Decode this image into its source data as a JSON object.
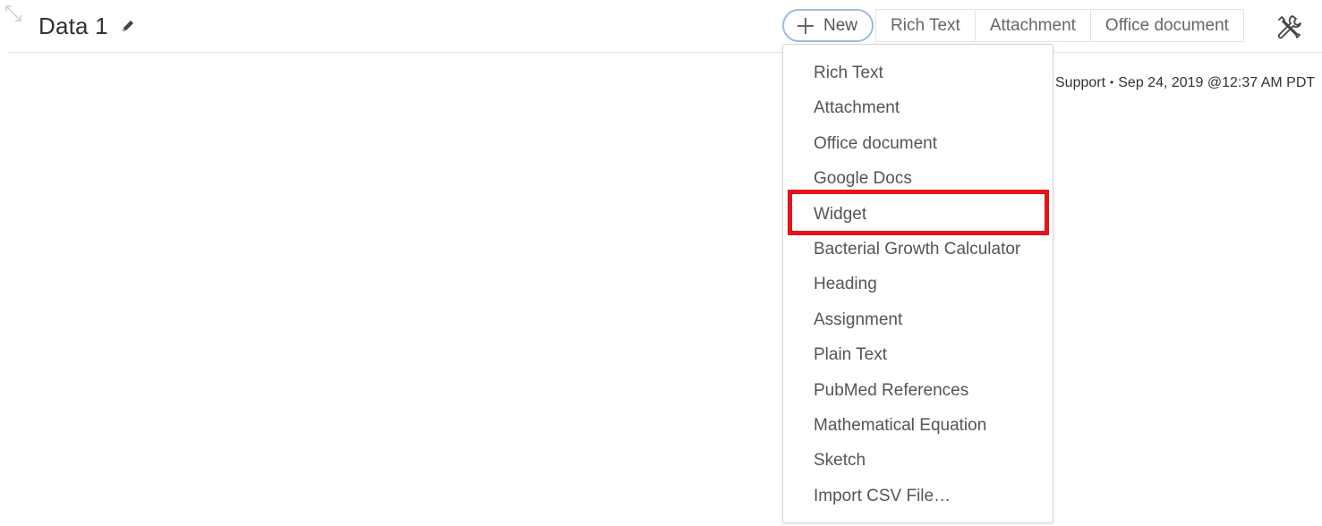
{
  "header": {
    "title": "Data 1",
    "edit_icon": "pencil-icon",
    "resize_icon": "resize-arrow-icon"
  },
  "toolbar": {
    "new_label": "New",
    "new_icon": "plus-icon",
    "buttons": [
      "Rich Text",
      "Attachment",
      "Office document"
    ],
    "tools_icon": "wrench-screwdriver-icon"
  },
  "meta": {
    "author": "Support",
    "separator": "•",
    "timestamp": "Sep 24, 2019 @12:37 AM PDT"
  },
  "dropdown": {
    "items": [
      "Rich Text",
      "Attachment",
      "Office document",
      "Google Docs",
      "Widget",
      "Bacterial Growth Calculator",
      "Heading",
      "Assignment",
      "Plain Text",
      "PubMed References",
      "Mathematical Equation",
      "Sketch",
      "Import CSV File…"
    ],
    "highlighted_item": "Widget"
  },
  "colors": {
    "highlight": "#e8121b",
    "new_button_border": "#9dbbe0",
    "text": "#555555"
  }
}
